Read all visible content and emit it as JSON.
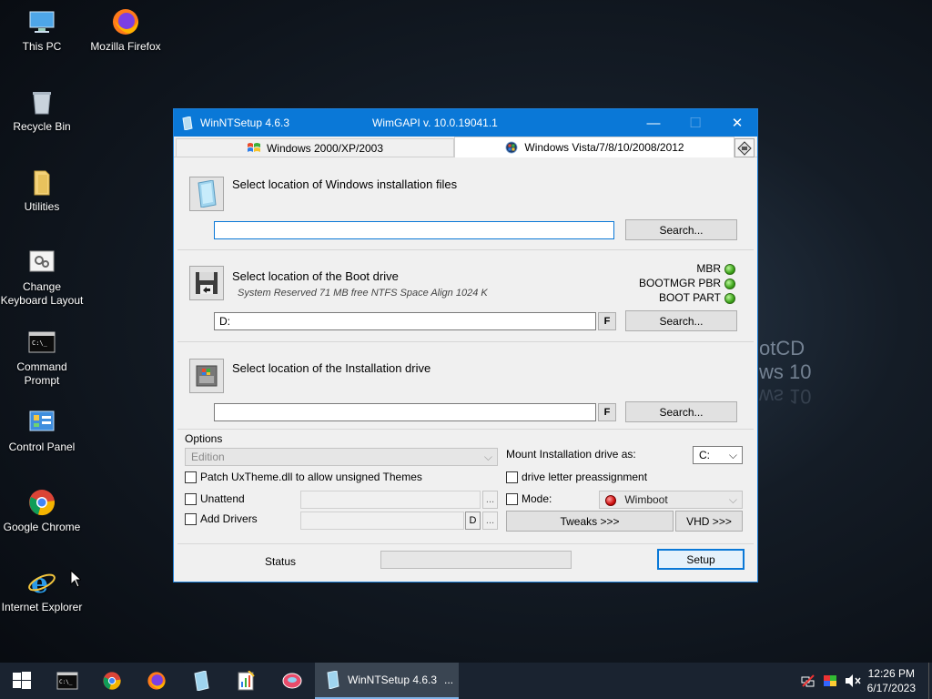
{
  "desktop": {
    "icons": [
      {
        "label": "This PC"
      },
      {
        "label": "Mozilla Firefox"
      },
      {
        "label": "Recycle Bin"
      },
      {
        "label": "Utilities"
      },
      {
        "label": "Change Keyboard Layout"
      },
      {
        "label": "Command Prompt"
      },
      {
        "label": "Control Panel"
      },
      {
        "label": "Google Chrome"
      },
      {
        "label": "Internet Explorer"
      }
    ],
    "wallpaper_text": [
      "otCD",
      "ws 10"
    ]
  },
  "window": {
    "title": "WinNTSetup 4.6.3",
    "subtitle": "WimGAPI v. 10.0.19041.1",
    "tabs": [
      {
        "label": "Windows 2000/XP/2003",
        "active": false
      },
      {
        "label": "Windows Vista/7/8/10/2008/2012",
        "active": true
      }
    ],
    "install_files": {
      "title": "Select location of Windows installation files",
      "path": "",
      "search_label": "Search..."
    },
    "boot_drive": {
      "title": "Select location of the Boot drive",
      "info": "System Reserved 71 MB free NTFS Space Align 1024 K",
      "path": "D:",
      "f_label": "F",
      "search_label": "Search...",
      "status": [
        {
          "label": "MBR",
          "color": "#3da51a"
        },
        {
          "label": "BOOTMGR PBR",
          "color": "#3da51a"
        },
        {
          "label": "BOOT PART",
          "color": "#3da51a"
        }
      ]
    },
    "install_drive": {
      "title": "Select location of the Installation drive",
      "path": "",
      "f_label": "F",
      "search_label": "Search..."
    },
    "options": {
      "label": "Options",
      "edition_placeholder": "Edition",
      "mount_label": "Mount Installation drive as:",
      "mount_value": "C:",
      "patch_label": "Patch UxTheme.dll to allow unsigned Themes",
      "drive_letter_label": "drive letter preassignment",
      "unattend_label": "Unattend",
      "mode_label": "Mode:",
      "mode_value": "Wimboot",
      "add_drivers_label": "Add Drivers",
      "d_label": "D",
      "ellipsis": "...",
      "tweaks_label": "Tweaks >>>",
      "vhd_label": "VHD >>>"
    },
    "footer": {
      "status_label": "Status",
      "setup_label": "Setup"
    }
  },
  "taskbar": {
    "active_task": "WinNTSetup 4.6.3",
    "active_task_suffix": "...",
    "time": "12:26 PM",
    "date": "6/17/2023"
  }
}
